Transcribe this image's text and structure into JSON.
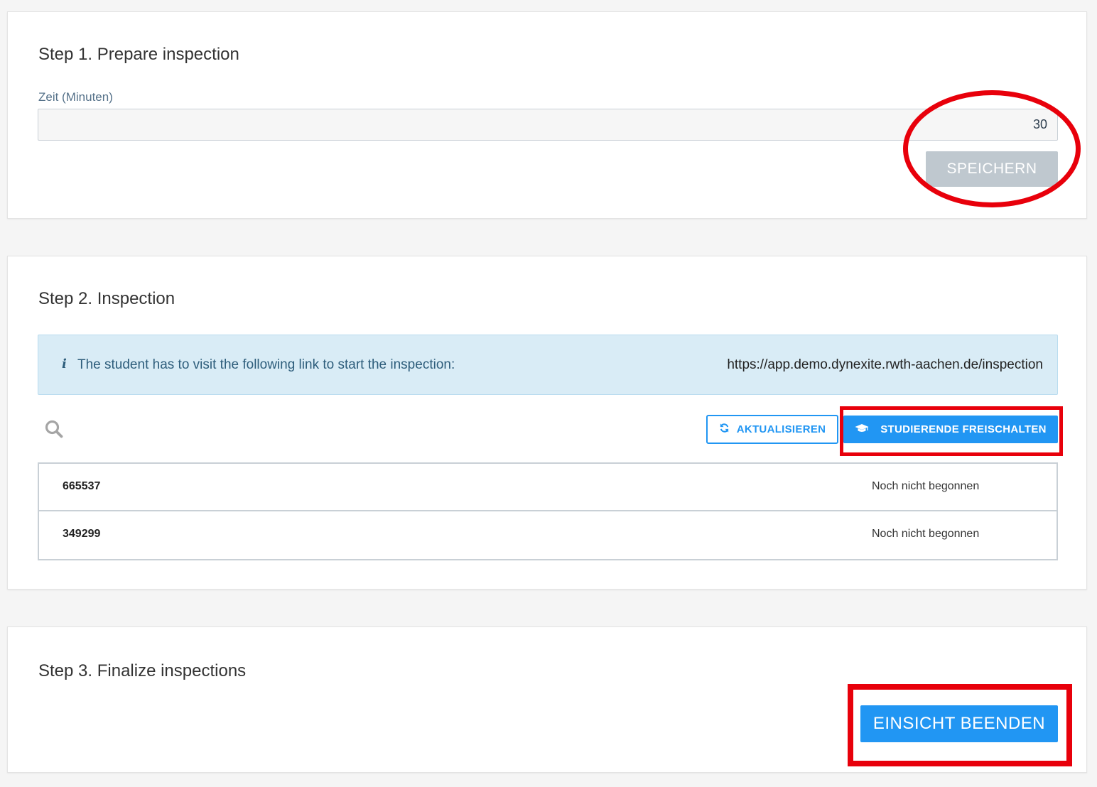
{
  "step1": {
    "title": "Step 1. Prepare inspection",
    "field_label": "Zeit (Minuten)",
    "field_value": "30",
    "save_label": "SPEICHERN"
  },
  "step2": {
    "title": "Step 2. Inspection",
    "info_icon": "i",
    "info_text": "The student has to visit the following link to start the inspection:",
    "info_link": "https://app.demo.dynexite.rwth-aachen.de/inspection",
    "refresh_label": "AKTUALISIEREN",
    "unlock_label": "STUDIERENDE FREISCHALTEN",
    "rows": [
      {
        "id": "665537",
        "status": "Noch nicht begonnen"
      },
      {
        "id": "349299",
        "status": "Noch nicht begonnen"
      }
    ]
  },
  "step3": {
    "title": "Step 3. Finalize inspections",
    "finish_label": "EINSICHT BEENDEN"
  },
  "icons": {
    "search": "search-icon",
    "refresh": "refresh-icon",
    "graduation": "graduation-cap-icon",
    "info": "info-icon"
  },
  "colors": {
    "primary": "#2196f3",
    "annotation_red": "#e8000b",
    "disabled": "#bfc8cf",
    "info_bg": "#d9ecf6"
  }
}
